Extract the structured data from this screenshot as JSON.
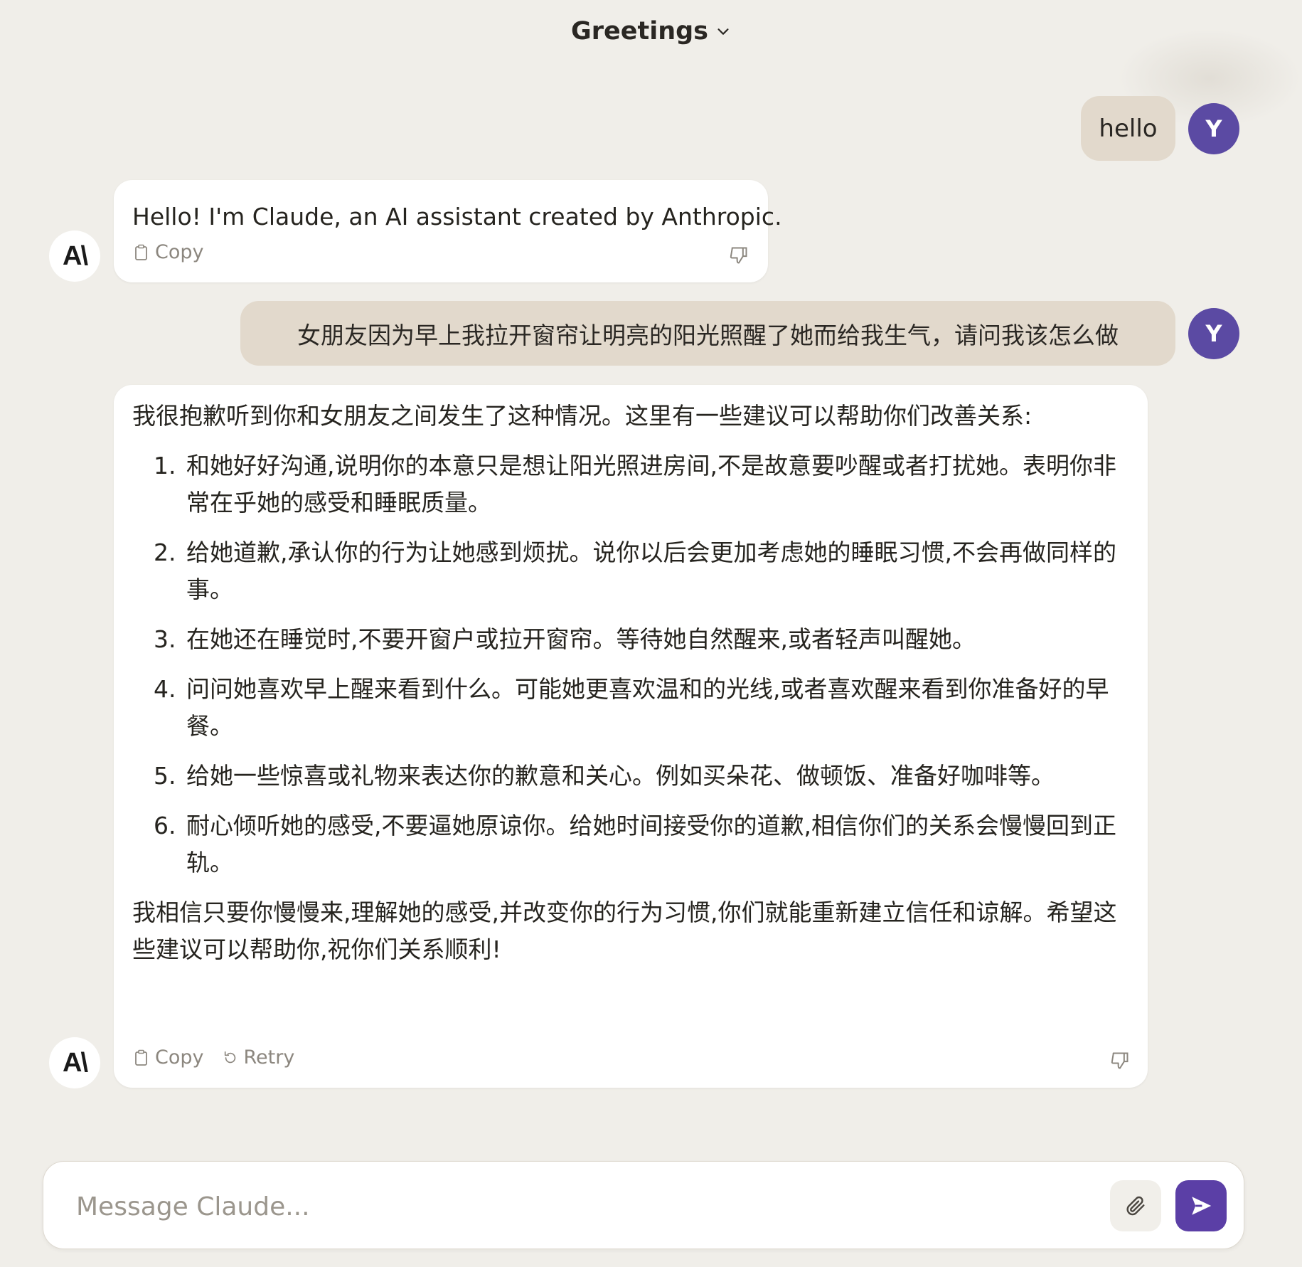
{
  "conversation": {
    "title": "Greetings"
  },
  "user": {
    "avatar_initial": "Y"
  },
  "assistant": {
    "avatar_logo": "A\\"
  },
  "messages": {
    "m1": {
      "text": "hello"
    },
    "m2": {
      "text": "Hello! I'm Claude, an AI assistant created by Anthropic.",
      "copy_label": "Copy"
    },
    "m3": {
      "text": "女朋友因为早上我拉开窗帘让明亮的阳光照醒了她而给我生气，请问我该怎么做"
    },
    "m4": {
      "intro": "我很抱歉听到你和女朋友之间发生了这种情况。这里有一些建议可以帮助你们改善关系:",
      "items": [
        "和她好好沟通,说明你的本意只是想让阳光照进房间,不是故意要吵醒或者打扰她。表明你非常在乎她的感受和睡眠质量。",
        "给她道歉,承认你的行为让她感到烦扰。说你以后会更加考虑她的睡眠习惯,不会再做同样的事。",
        "在她还在睡觉时,不要开窗户或拉开窗帘。等待她自然醒来,或者轻声叫醒她。",
        "问问她喜欢早上醒来看到什么。可能她更喜欢温和的光线,或者喜欢醒来看到你准备好的早餐。",
        "给她一些惊喜或礼物来表达你的歉意和关心。例如买朵花、做顿饭、准备好咖啡等。",
        "耐心倾听她的感受,不要逼她原谅你。给她时间接受你的道歉,相信你们的关系会慢慢回到正轨。"
      ],
      "closing": "我相信只要你慢慢来,理解她的感受,并改变你的行为习惯,你们就能重新建立信任和谅解。希望这些建议可以帮助你,祝你们关系顺利!",
      "copy_label": "Copy",
      "retry_label": "Retry"
    }
  },
  "composer": {
    "placeholder": "Message Claude..."
  },
  "colors": {
    "background": "#f0eee9",
    "user_bubble": "#e2d9cc",
    "avatar": "#5b4aa3",
    "send_button": "#5b3fa6"
  },
  "icons": [
    "chevron-down-icon",
    "copy-icon",
    "retry-icon",
    "thumbs-down-icon",
    "paperclip-icon",
    "send-icon"
  ]
}
